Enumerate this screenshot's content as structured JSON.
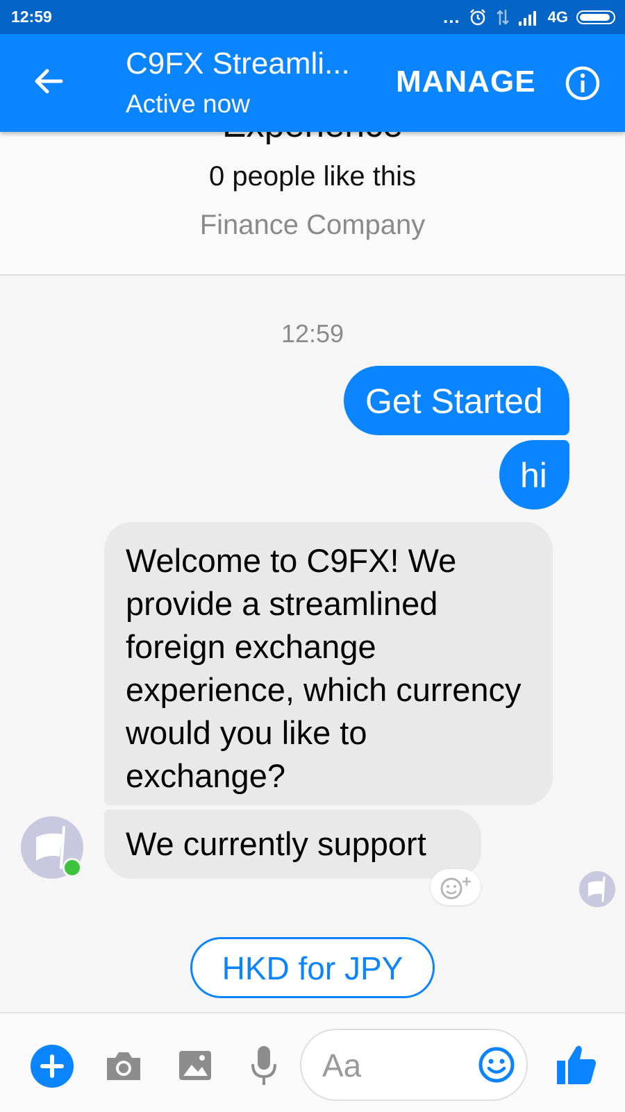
{
  "status_bar": {
    "time": "12:59",
    "dots": "...",
    "network": "4G",
    "icons": [
      "alarm-icon",
      "data-arrows-icon",
      "signal-icon",
      "battery-icon"
    ]
  },
  "app_bar": {
    "title": "C9FX Streamli...",
    "subtitle": "Active now",
    "manage_label": "MANAGE",
    "icons": [
      "back-arrow-icon",
      "info-icon"
    ]
  },
  "page_header": {
    "cutoff_title": "Experience",
    "likes": "0 people like this",
    "category": "Finance Company"
  },
  "conversation": {
    "timestamp": "12:59",
    "messages": [
      {
        "from": "user",
        "text": "Get Started"
      },
      {
        "from": "user",
        "text": "hi"
      },
      {
        "from": "bot",
        "text": "Welcome to C9FX! We provide a streamlined foreign exchange experience, which currency would you like to exchange?"
      },
      {
        "from": "bot",
        "text": "We currently support"
      }
    ],
    "quick_reply": "HKD for JPY"
  },
  "composer": {
    "placeholder": "Aa",
    "icons": [
      "plus-icon",
      "camera-icon",
      "gallery-icon",
      "microphone-icon",
      "emoji-icon",
      "thumbs-up-icon"
    ]
  },
  "colors": {
    "status_bar": "#0565c6",
    "app_bar": "#0a84ff",
    "user_bubble": "#0a84ff",
    "bot_bubble": "#e9e9e9",
    "online_dot": "#3cc43c"
  }
}
